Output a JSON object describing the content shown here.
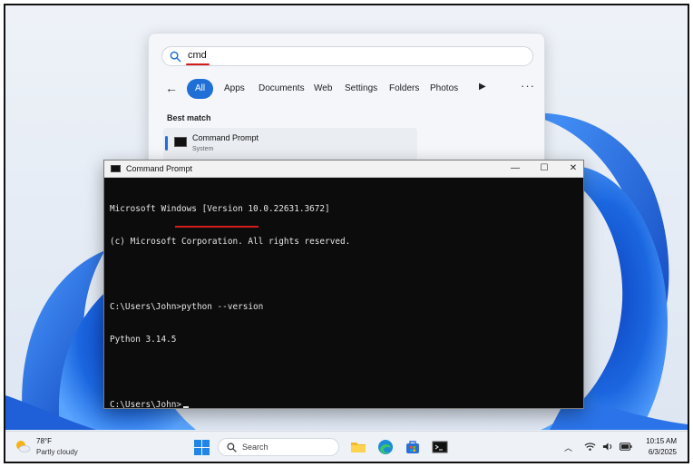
{
  "search": {
    "query": "cmd",
    "filters": [
      "All",
      "Apps",
      "Documents",
      "Web",
      "Settings",
      "Folders",
      "Photos"
    ],
    "best_match_label": "Best match",
    "result": {
      "title": "Command Prompt",
      "subtitle": "System"
    }
  },
  "cmd": {
    "title": "Command Prompt",
    "lines": [
      "Microsoft Windows [Version 10.0.22631.3672]",
      "(c) Microsoft Corporation. All rights reserved.",
      "",
      "C:\\Users\\John>python --version",
      "Python 3.14.5",
      "",
      "C:\\Users\\John>"
    ]
  },
  "taskbar": {
    "weather": {
      "temp": "78°F",
      "desc": "Partly cloudy"
    },
    "search_placeholder": "Search",
    "clock": {
      "time": "10:15 AM",
      "date": "6/3/2025"
    }
  },
  "colors": {
    "accent": "#1f6fd6",
    "annotation": "#d21c1c",
    "terminal_bg": "#0c0c0c"
  },
  "icons": [
    "search-icon",
    "back-arrow-icon",
    "play-icon",
    "more-icon",
    "cmd-icon",
    "minimize-icon",
    "maximize-icon",
    "close-icon",
    "weather-icon",
    "windows-start-icon",
    "file-explorer-icon",
    "edge-icon",
    "store-icon",
    "terminal-icon",
    "chevron-up-icon",
    "wifi-icon",
    "speaker-icon",
    "battery-icon"
  ]
}
